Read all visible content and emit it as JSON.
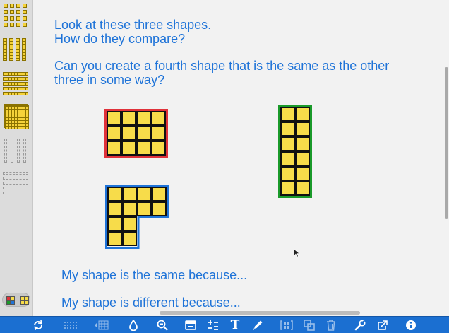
{
  "canvas": {
    "prompt_line_1": "Look at these three shapes.\nHow do they compare?",
    "prompt_line_2": "Can you create a fourth shape that is the same as the other\nthree in some way?",
    "response_same": "My shape is the same because...",
    "response_different": "My shape is different because..."
  },
  "shapes": {
    "red": {
      "border_color": "#e0323a",
      "rows": 3,
      "cols": 4
    },
    "blue": {
      "border_color": "#1e73d8",
      "rows": 4,
      "cols": 4,
      "cells": [
        [
          1,
          1,
          1,
          1
        ],
        [
          1,
          1,
          1,
          1
        ],
        [
          1,
          1,
          0,
          0
        ],
        [
          1,
          1,
          0,
          0
        ]
      ]
    },
    "green": {
      "border_color": "#1a9a2a",
      "rows": 6,
      "cols": 2
    }
  },
  "colors": {
    "text": "#1e73d8",
    "toolbar": "#1b6fd1",
    "cube": "#f7dc4a"
  },
  "sidebar": {
    "palette": [
      "unit-cubes",
      "ten-rods",
      "ten-flats",
      "hundred-block",
      "ten-rod-outlines",
      "flat-outlines"
    ],
    "toggle": "cube-color-toggle"
  },
  "toolbar": {
    "buttons": [
      "refresh-icon",
      "grid-dots-icon",
      "grid-arrow-icon",
      "droplet-icon",
      "zoom-out-icon",
      "keyboard-icon",
      "plus-minus-icon",
      "text-icon",
      "pen-icon",
      "group-icon",
      "duplicate-icon",
      "trash-icon",
      "wrench-icon",
      "share-icon",
      "info-icon"
    ],
    "text_tool_label": "T"
  }
}
